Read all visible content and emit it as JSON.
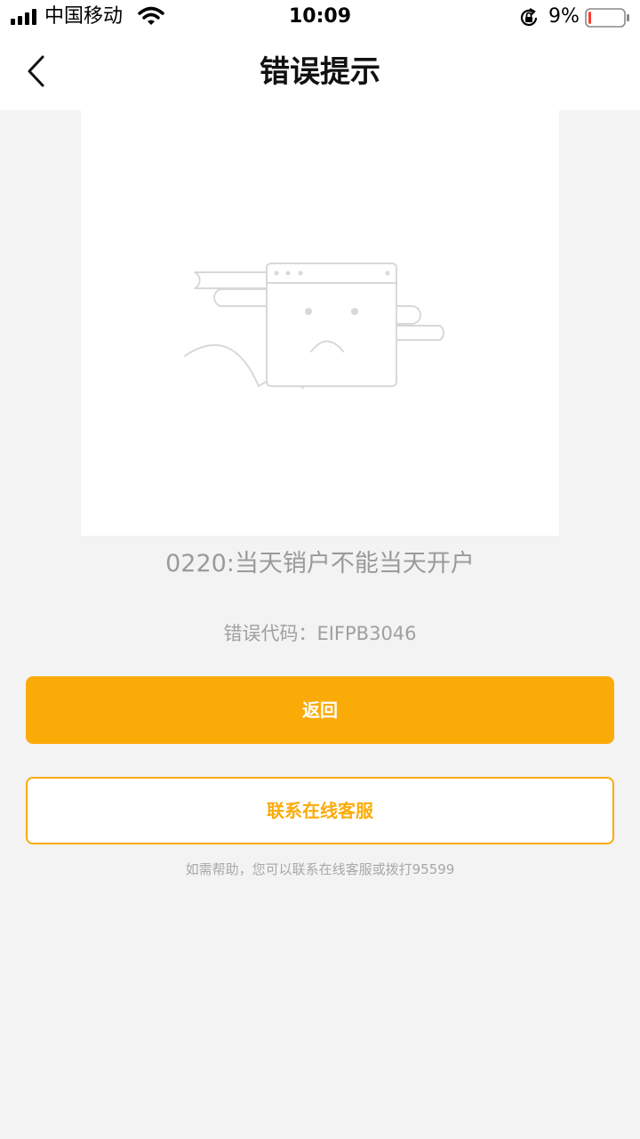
{
  "status_bar": {
    "carrier": "中国移动",
    "time": "10:09",
    "battery_percent": "9%",
    "battery_level": 0.09,
    "signal_icon": "cellular-signal-icon",
    "wifi_icon": "wifi-icon",
    "lock_icon": "orientation-lock-icon",
    "battery_icon": "battery-low-icon"
  },
  "nav": {
    "title": "错误提示",
    "back_icon": "chevron-left-icon"
  },
  "illustration": {
    "icon": "sad-browser-window-illustration"
  },
  "error": {
    "message": "0220:当天销户不能当天开户",
    "code": "错误代码：EIFPB3046"
  },
  "actions": {
    "back_label": "返回",
    "contact_label": "联系在线客服"
  },
  "help": {
    "text": "如需帮助，您可以联系在线客服或拨打95599"
  },
  "colors": {
    "accent": "#fbab08",
    "background": "#f3f3f3",
    "battery_low": "#ff3b30"
  }
}
